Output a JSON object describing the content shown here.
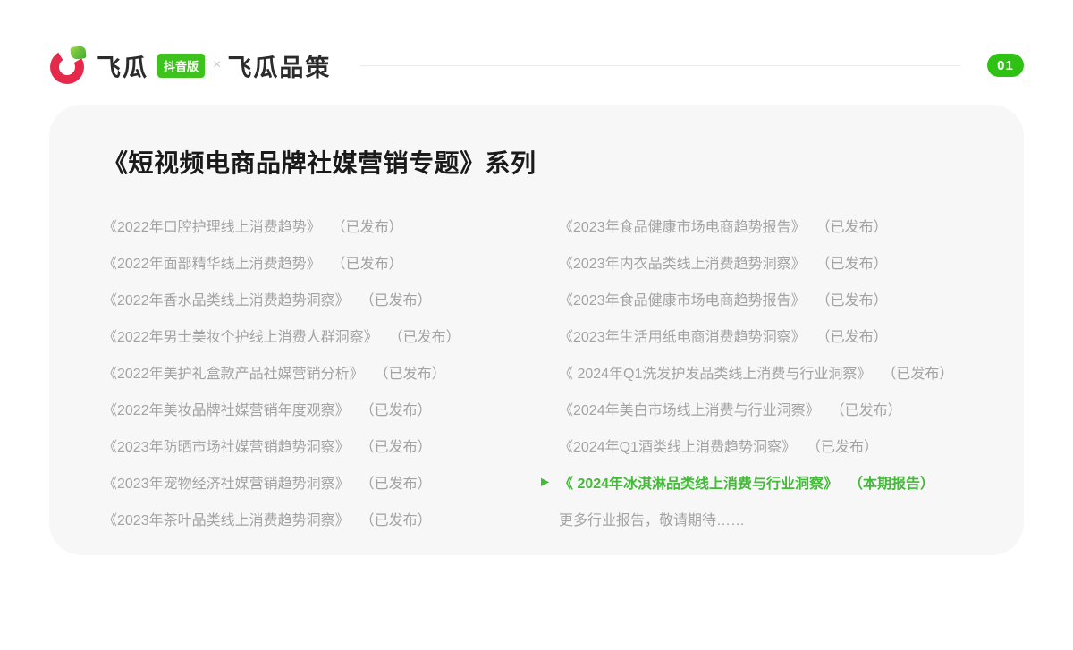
{
  "header": {
    "logo_text": "飞瓜",
    "logo_badge": "抖音版",
    "separator": "×",
    "partner_text": "飞瓜品策",
    "page_number": "01"
  },
  "card": {
    "title": "《短视频电商品牌社媒营销专题》系列",
    "left_items": [
      {
        "title": "《2022年口腔护理线上消费趋势》",
        "status": "（已发布）"
      },
      {
        "title": "《2022年面部精华线上消费趋势》",
        "status": "（已发布）"
      },
      {
        "title": "《2022年香水品类线上消费趋势洞察》",
        "status": "（已发布）"
      },
      {
        "title": "《2022年男士美妆个护线上消费人群洞察》",
        "status": "（已发布）"
      },
      {
        "title": "《2022年美护礼盒款产品社媒营销分析》",
        "status": "（已发布）"
      },
      {
        "title": "《2022年美妆品牌社媒营销年度观察》",
        "status": "（已发布）"
      },
      {
        "title": "《2023年防晒市场社媒营销趋势洞察》",
        "status": "（已发布）"
      },
      {
        "title": "《2023年宠物经济社媒营销趋势洞察》",
        "status": "（已发布）"
      },
      {
        "title": "《2023年茶叶品类线上消费趋势洞察》",
        "status": "（已发布）"
      }
    ],
    "right_items": [
      {
        "title": "《2023年食品健康市场电商趋势报告》",
        "status": "（已发布）"
      },
      {
        "title": "《2023年内衣品类线上消费趋势洞察》",
        "status": "（已发布）"
      },
      {
        "title": "《2023年食品健康市场电商趋势报告》",
        "status": "（已发布）"
      },
      {
        "title": "《2023年生活用纸电商消费趋势洞察》",
        "status": "（已发布）"
      },
      {
        "title": "《 2024年Q1洗发护发品类线上消费与行业洞察》",
        "status": "（已发布）"
      },
      {
        "title": "《2024年美白市场线上消费与行业洞察》",
        "status": "（已发布）"
      },
      {
        "title": "《2024年Q1酒类线上消费趋势洞察》",
        "status": "（已发布）"
      },
      {
        "title": "《 2024年冰淇淋品类线上消费与行业洞察》",
        "status": "（本期报告）",
        "highlighted": true,
        "marker": "▶"
      },
      {
        "title": "更多行业报告，敬请期待……",
        "status": ""
      }
    ]
  },
  "colors": {
    "brand_red": "#E5294B",
    "brand_green": "#3EC21D",
    "badge_green": "#2FC215",
    "highlight_green": "#45B93A",
    "card_background": "#F7F7F8",
    "item_gray": "#A3A3A3",
    "title_dark": "#1A1A1A"
  }
}
